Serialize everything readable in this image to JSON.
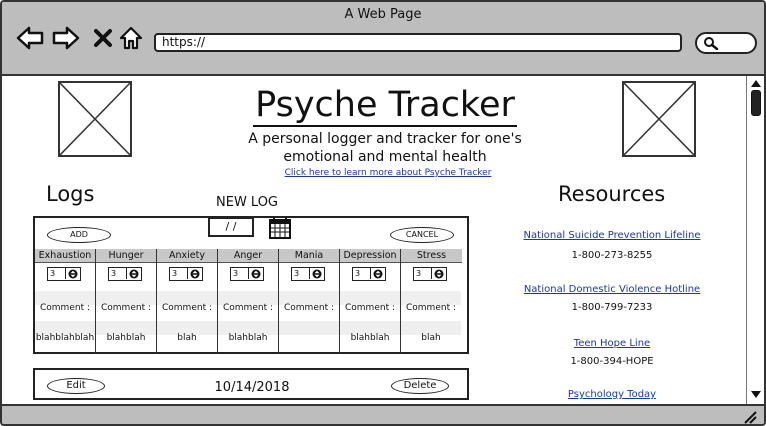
{
  "window": {
    "title": "A Web Page"
  },
  "browser": {
    "url": "https://",
    "icons": [
      "back-arrow-icon",
      "forward-arrow-icon",
      "close-x-icon",
      "home-icon",
      "search-icon"
    ]
  },
  "header": {
    "title": "Psyche Tracker",
    "subtitle_line1": "A personal logger and tracker for one's",
    "subtitle_line2": "emotional and mental health",
    "learn_more": "Click here to learn more about Psyche Tracker"
  },
  "logs": {
    "heading": "Logs",
    "new_log_label": "NEW LOG",
    "add_label": "ADD",
    "cancel_label": "CANCEL",
    "date_value": "/ /",
    "columns": [
      {
        "name": "Exhaustion",
        "value": "3",
        "comment_label": "Comment :",
        "comment": "blahblahblah"
      },
      {
        "name": "Hunger",
        "value": "3",
        "comment_label": "Comment :",
        "comment": "blahblah"
      },
      {
        "name": "Anxiety",
        "value": "3",
        "comment_label": "Comment :",
        "comment": "blah"
      },
      {
        "name": "Anger",
        "value": "3",
        "comment_label": "Comment :",
        "comment": "blahblah"
      },
      {
        "name": "Mania",
        "value": "3",
        "comment_label": "Comment :",
        "comment": ""
      },
      {
        "name": "Depression",
        "value": "3",
        "comment_label": "Comment :",
        "comment": "blahblah"
      },
      {
        "name": "Stress",
        "value": "3",
        "comment_label": "Comment :",
        "comment": "blah"
      }
    ],
    "entry": {
      "edit_label": "Edit",
      "date": "10/14/2018",
      "delete_label": "Delete"
    }
  },
  "resources": {
    "heading": "Resources",
    "items": [
      {
        "name": "National Suicide Prevention Lifeline",
        "phone": "1-800-273-8255"
      },
      {
        "name": "National Domestic Violence Hotline",
        "phone": "1-800-799-7233"
      },
      {
        "name": "Teen Hope Line",
        "phone": "1-800-394-HOPE"
      },
      {
        "name": "Psychology Today",
        "phone": ""
      }
    ]
  },
  "colors": {
    "chrome": "#bdbdbd",
    "link": "#1a3a9c",
    "header_cell": "#c8c8c8"
  }
}
